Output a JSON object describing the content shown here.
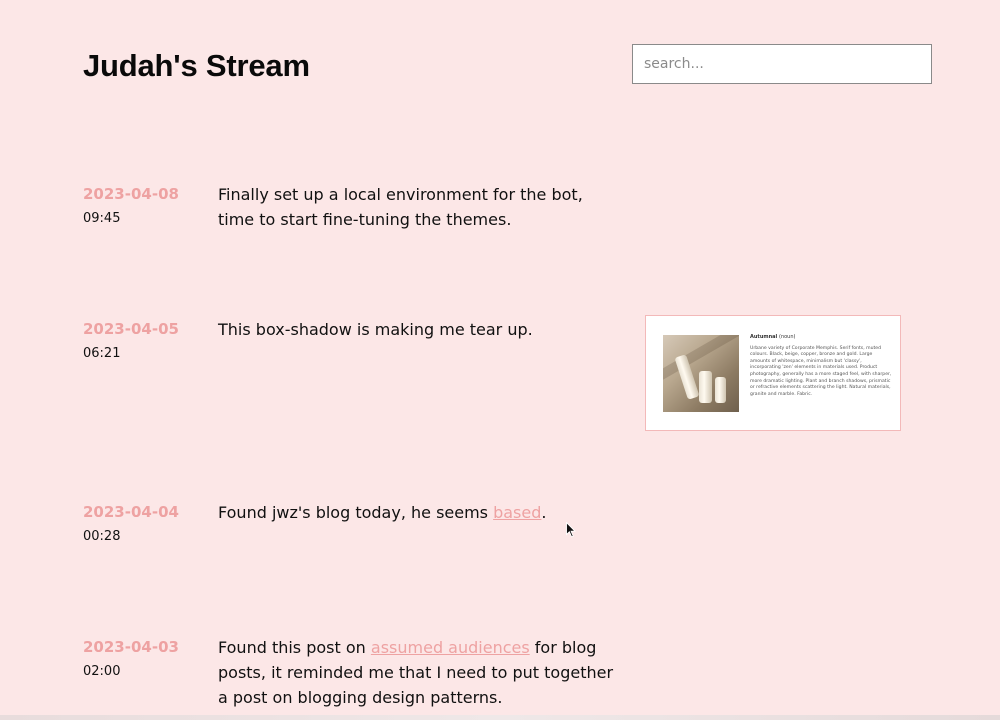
{
  "header": {
    "title": "Judah's Stream",
    "search_placeholder": "search..."
  },
  "posts": [
    {
      "date": "2023-04-08",
      "time": "09:45",
      "text": "Finally set up a local environment for the bot, time to start fine-tuning the themes."
    },
    {
      "date": "2023-04-05",
      "time": "06:21",
      "text": "This box-shadow is making me tear up.",
      "attachment": {
        "heading": "Autumnal",
        "heading_tag": "(noun)",
        "body": "Urbane variety of Corporate Memphis. Serif fonts, muted colours. Black, beige, copper, bronze and gold. Large amounts of whitespace, minimalism but 'classy', incorporating 'zen' elements in materials used. Product photography, generally has a more staged feel, with sharper, more dramatic lighting. Plant and branch shadows, prismatic or refractive elements scattering the light. Natural materials, granite and marble. Fabric."
      }
    },
    {
      "date": "2023-04-04",
      "time": "00:28",
      "text_before": "Found jwz's blog today, he seems ",
      "link": "based",
      "text_after": "."
    },
    {
      "date": "2023-04-03",
      "time": "02:00",
      "text_before": "Found this post on ",
      "link": "assumed audiences",
      "text_after": " for blog posts, it reminded me that I need to put together a post on blogging design patterns."
    }
  ],
  "colors": {
    "background": "#fce7e7",
    "accent": "#eea2a2",
    "text": "#111111"
  }
}
